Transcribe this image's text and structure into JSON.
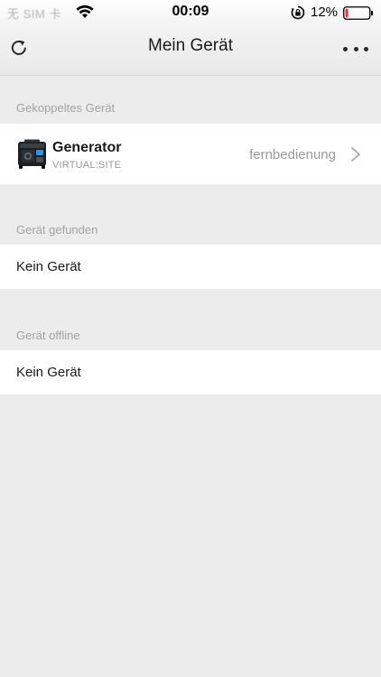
{
  "status_bar": {
    "carrier": "无 SIM 卡",
    "time": "00:09",
    "battery_percent": "12%",
    "battery_level": 0.12,
    "battery_color": "#e0383e",
    "icons": [
      "wifi-icon",
      "rotation-lock-icon",
      "battery-icon"
    ]
  },
  "nav": {
    "title": "Mein Gerät",
    "left_icon": "refresh-icon",
    "right_icon": "more-icon"
  },
  "paired": {
    "header": "Gekoppeltes Gerät",
    "device": {
      "name": "Generator",
      "subtitle": "VIRTUAL:SITE",
      "status": "fernbedienung",
      "icon": "generator-icon",
      "trailing_icon": "chevron-right-icon"
    }
  },
  "found": {
    "header": "Gerät gefunden",
    "empty_label": "Kein Gerät"
  },
  "offline": {
    "header": "Gerät offline",
    "empty_label": "Kein Gerät"
  }
}
